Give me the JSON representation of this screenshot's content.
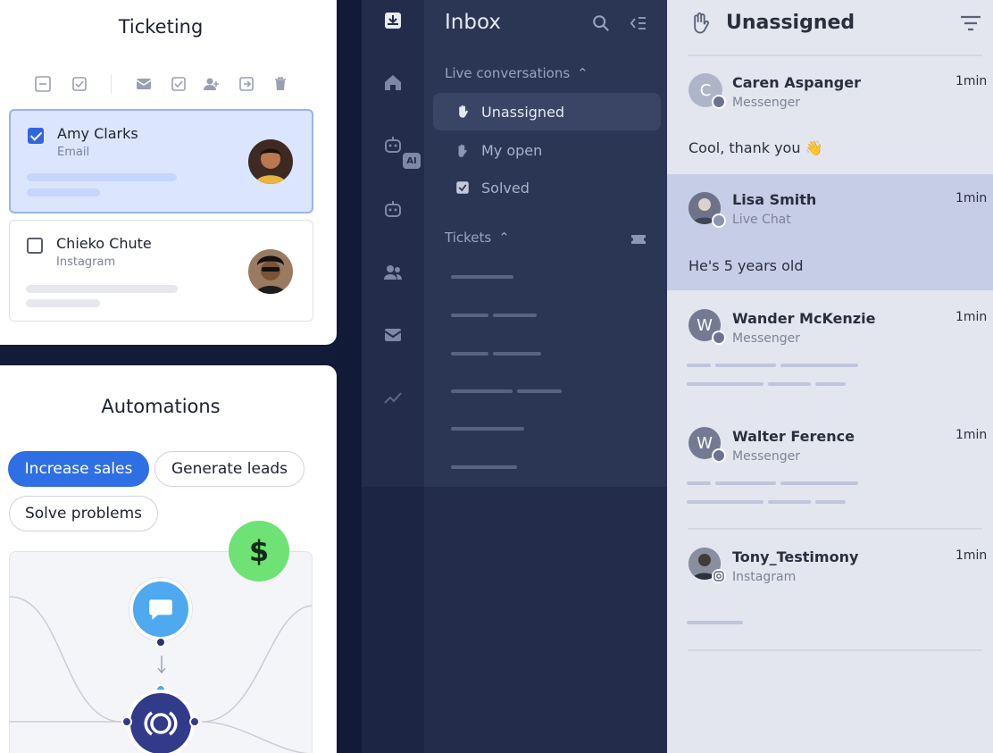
{
  "ticketing": {
    "title": "Ticketing",
    "tickets": [
      {
        "name": "Amy Clarks",
        "source": "Email",
        "checked": true
      },
      {
        "name": "Chieko Chute",
        "source": "Instagram",
        "checked": false
      }
    ]
  },
  "automations": {
    "title": "Automations",
    "chips": [
      "Increase sales",
      "Generate leads",
      "Solve problems"
    ],
    "active_chip": "Increase sales",
    "dollar_symbol": "$"
  },
  "inbox": {
    "title": "Inbox",
    "live_section": "Live conversations",
    "nav": [
      {
        "label": "Unassigned",
        "active": true
      },
      {
        "label": "My open",
        "active": false
      },
      {
        "label": "Solved",
        "active": false
      }
    ],
    "tickets_section": "Tickets"
  },
  "unassigned": {
    "title": "Unassigned",
    "conversations": [
      {
        "name": "Caren Aspanger",
        "source": "Messenger",
        "time": "1min",
        "message": "Cool, thank you 👋",
        "initial": "C"
      },
      {
        "name": "Lisa Smith",
        "source": "Live Chat",
        "time": "1min",
        "message": "He's 5 years old",
        "initial": ""
      },
      {
        "name": "Wander McKenzie",
        "source": "Messenger",
        "time": "1min",
        "message": "",
        "initial": "W"
      },
      {
        "name": "Walter Ference",
        "source": "Messenger",
        "time": "1min",
        "message": "",
        "initial": "W"
      },
      {
        "name": "Tony_Testimony",
        "source": "Instagram",
        "time": "1min",
        "message": "",
        "initial": ""
      }
    ]
  },
  "colors": {
    "accent_blue": "#2f6fe4",
    "dark_navy": "#111a36",
    "selected_row": "#c6cde6",
    "money_green": "#6ee275"
  }
}
